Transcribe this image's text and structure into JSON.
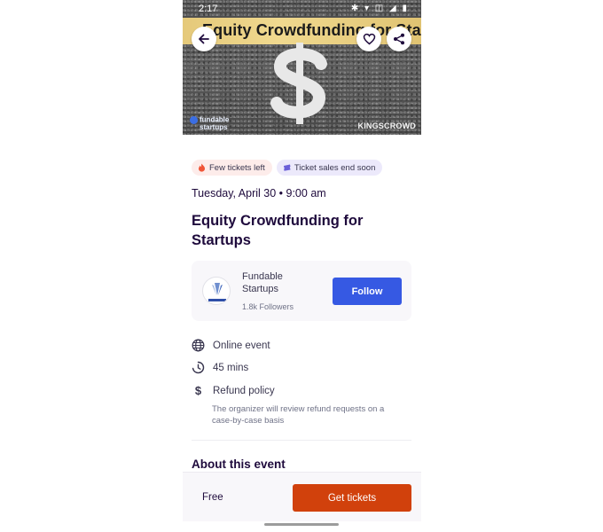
{
  "status_bar": {
    "time": "2:17",
    "icons": "✱ ▾ ◫ ◢ ▮"
  },
  "hero": {
    "banner_text": "Equity Crowdfunding for Startups",
    "brand_left_line1": "fundable",
    "brand_left_line2": "startups",
    "brand_right": "KINGSCROWD"
  },
  "badges": [
    {
      "label": "Few tickets left",
      "icon": "fire-icon",
      "color": "#fdecea"
    },
    {
      "label": "Ticket sales end soon",
      "icon": "ticket-icon",
      "color": "#ece9fb"
    }
  ],
  "event": {
    "date": "Tuesday, April 30 • 9:00 am",
    "title": "Equity Crowdfunding for Startups"
  },
  "organizer": {
    "name": "Fundable Startups",
    "followers": "1.8k Followers",
    "follow_label": "Follow"
  },
  "details": {
    "location": "Online event",
    "duration": "45 mins",
    "refund_label": "Refund policy",
    "refund_desc": "The organizer will review refund requests on a case-by-case basis"
  },
  "about_heading": "About this event",
  "footer": {
    "price": "Free",
    "cta": "Get tickets"
  },
  "colors": {
    "primary": "#3659e3",
    "cta": "#d1410c",
    "text": "#1e0a3c"
  }
}
